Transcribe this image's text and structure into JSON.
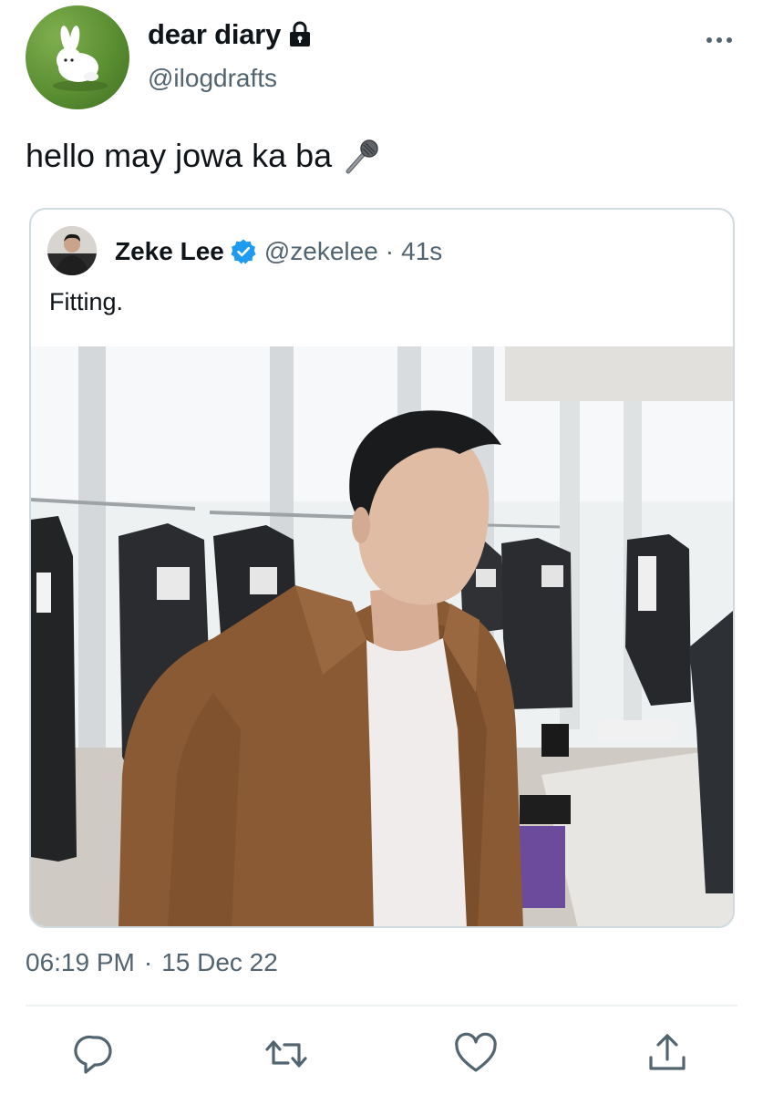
{
  "author": {
    "display_name": "dear diary",
    "handle": "@ilogdrafts",
    "protected": true
  },
  "tweet": {
    "text": "hello may jowa ka ba",
    "emoji": "microphone-emoji",
    "timestamp_time": "06:19 PM",
    "timestamp_separator": "·",
    "timestamp_date": "15 Dec 22"
  },
  "quoted_tweet": {
    "display_name": "Zeke Lee",
    "verified": true,
    "handle": "@zekelee",
    "separator": "·",
    "time_ago": "41s",
    "text": "Fitting.",
    "has_photo": true
  },
  "actions": [
    "reply-icon",
    "retweet-icon",
    "like-icon",
    "share-icon"
  ],
  "colors": {
    "text": "#0f1419",
    "secondary": "#536471",
    "verified": "#1d9bf0",
    "border": "#cfd9de"
  }
}
